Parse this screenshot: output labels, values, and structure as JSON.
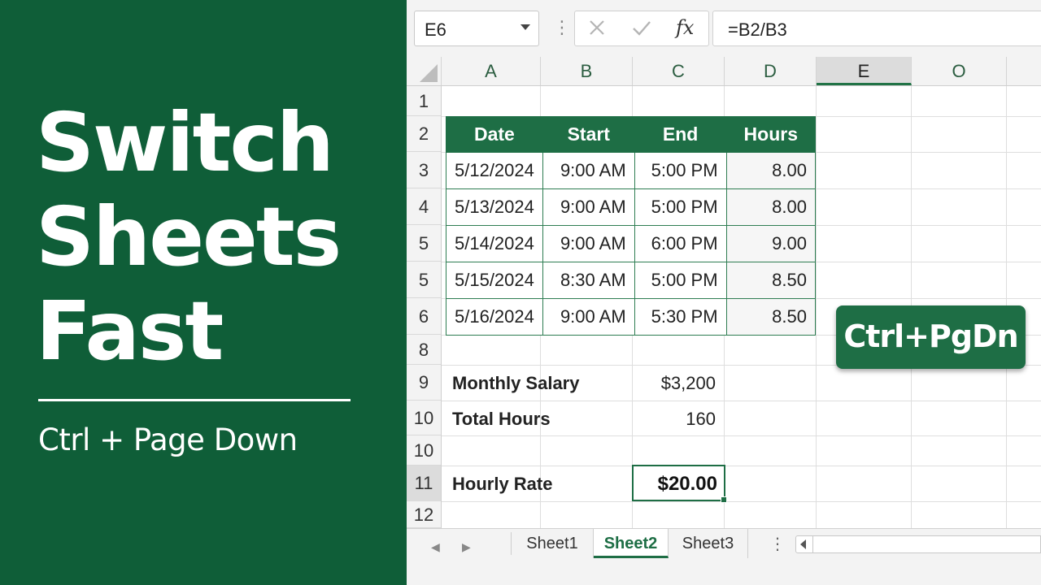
{
  "promo": {
    "title_line1": "Switch",
    "title_line2": "Sheets",
    "title_line3": "Fast",
    "subtitle": "Ctrl + Page Down"
  },
  "formula_bar": {
    "name_box": "E6",
    "fx_symbol": "fx",
    "formula": "=B2/B3"
  },
  "columns": [
    "A",
    "B",
    "C",
    "D",
    "E",
    "O"
  ],
  "selected_column": "E",
  "rows": [
    "1",
    "2",
    "3",
    "4",
    "5",
    "5",
    "6",
    "8",
    "9",
    "10",
    "10",
    "11",
    "12"
  ],
  "table": {
    "headers": [
      "Date",
      "Start",
      "End",
      "Hours"
    ],
    "rows": [
      [
        "5/12/2024",
        "9:00 AM",
        "5:00 PM",
        "8.00"
      ],
      [
        "5/13/2024",
        "9:00 AM",
        "5:00 PM",
        "8.00"
      ],
      [
        "5/14/2024",
        "9:00 AM",
        "6:00 PM",
        "9.00"
      ],
      [
        "5/15/2024",
        "8:30 AM",
        "5:00 PM",
        "8.50"
      ],
      [
        "5/16/2024",
        "9:00 AM",
        "5:30 PM",
        "8.50"
      ]
    ]
  },
  "summary": {
    "salary_label": "Monthly Salary",
    "salary_value": "$3,200",
    "hours_label": "Total Hours",
    "hours_value": "160",
    "rate_label": "Hourly Rate",
    "rate_value": "$20.00"
  },
  "shortcut_badge": "Ctrl+PgDn",
  "sheets": {
    "tabs": [
      "Sheet1",
      "Sheet2",
      "Sheet3"
    ],
    "active": "Sheet2",
    "more": "⋮"
  },
  "colors": {
    "promo_green": "#0f5e38",
    "excel_green": "#1e6e45"
  }
}
